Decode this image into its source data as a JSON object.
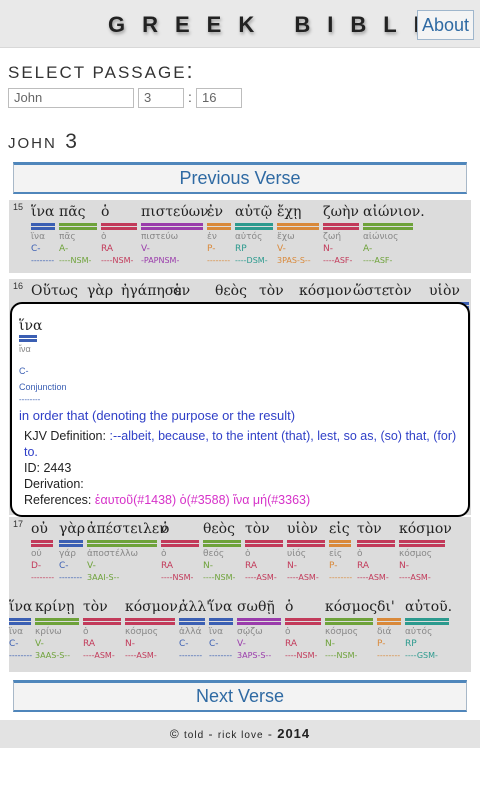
{
  "header": {
    "title": "GREEK BIBLE",
    "about_label": "About"
  },
  "select": {
    "label": "SELECT PASSAGE",
    "colon": ":",
    "book": "John",
    "chapter": "3",
    "verse_sep": ":",
    "verse": "16"
  },
  "chapter_heading": {
    "book": "JOHN",
    "number": "3"
  },
  "nav": {
    "prev_label": "Previous Verse",
    "next_label": "Next Verse"
  },
  "verses": {
    "v15": {
      "number": "15",
      "words": [
        {
          "greek": "ἵνα",
          "lemma": "ἵνα",
          "pos": "C-",
          "parse": "--------",
          "color": "blue"
        },
        {
          "greek": "πᾶς",
          "lemma": "πᾶς",
          "pos": "A-",
          "parse": "----NSM-",
          "color": "green"
        },
        {
          "greek": "ὁ",
          "lemma": "ὁ",
          "pos": "RA",
          "parse": "----NSM-",
          "color": "red"
        },
        {
          "greek": "πιστεύων",
          "lemma": "πιστεύω",
          "pos": "V-",
          "parse": "-PAPNSM-",
          "color": "purple"
        },
        {
          "greek": "ἐν",
          "lemma": "ἐν",
          "pos": "P-",
          "parse": "--------",
          "color": "orange"
        },
        {
          "greek": "αὐτῷ",
          "lemma": "αὐτός",
          "pos": "RP",
          "parse": "----DSM-",
          "color": "teal"
        },
        {
          "greek": "ἔχῃ",
          "lemma": "ἔχω",
          "pos": "V-",
          "parse": "3PAS-S--",
          "color": "orange"
        },
        {
          "greek": "ζωὴν",
          "lemma": "ζωή",
          "pos": "N-",
          "parse": "----ASF-",
          "color": "red"
        },
        {
          "greek": "αἰώνιον.",
          "lemma": "αἰώνιος",
          "pos": "A-",
          "parse": "----ASF-",
          "color": "green"
        }
      ]
    },
    "v16": {
      "number": "16",
      "words": [
        {
          "greek": "Οὕτως"
        },
        {
          "greek": "γὰρ"
        },
        {
          "greek": "ἠγάπησεν"
        },
        {
          "greek": "ὁ"
        },
        {
          "greek": "θεὸς"
        },
        {
          "greek": "τὸν"
        },
        {
          "greek": "κόσμον"
        },
        {
          "greek": "ὥστε"
        },
        {
          "greek": "τὸν"
        },
        {
          "greek": "υἱὸν"
        }
      ]
    },
    "v17": {
      "number": "17",
      "line1": [
        {
          "greek": "οὐ",
          "lemma": "οὐ",
          "pos": "D-",
          "parse": "--------",
          "color": "red"
        },
        {
          "greek": "γὰρ",
          "lemma": "γάρ",
          "pos": "C-",
          "parse": "--------",
          "color": "blue"
        },
        {
          "greek": "ἀπέστειλεν",
          "lemma": "ἀποστέλλω",
          "pos": "V-",
          "parse": "3AAI-S--",
          "color": "green"
        },
        {
          "greek": "ὁ",
          "lemma": "ὁ",
          "pos": "RA",
          "parse": "----NSM-",
          "color": "red"
        },
        {
          "greek": "θεὸς",
          "lemma": "θεός",
          "pos": "N-",
          "parse": "----NSM-",
          "color": "green"
        },
        {
          "greek": "τὸν",
          "lemma": "ὁ",
          "pos": "RA",
          "parse": "----ASM-",
          "color": "red"
        },
        {
          "greek": "υἱὸν",
          "lemma": "υἱός",
          "pos": "N-",
          "parse": "----ASM-",
          "color": "red"
        },
        {
          "greek": "εἰς",
          "lemma": "εἰς",
          "pos": "P-",
          "parse": "--------",
          "color": "orange"
        },
        {
          "greek": "τὸν",
          "lemma": "ὁ",
          "pos": "RA",
          "parse": "----ASM-",
          "color": "red"
        },
        {
          "greek": "κόσμον",
          "lemma": "κόσμος",
          "pos": "N-",
          "parse": "----ASM-",
          "color": "red"
        }
      ],
      "line2": [
        {
          "greek": "ἵνα",
          "lemma": "ἵνα",
          "pos": "C-",
          "parse": "--------",
          "color": "blue"
        },
        {
          "greek": "κρίνῃ",
          "lemma": "κρίνω",
          "pos": "V-",
          "parse": "3AAS-S--",
          "color": "green"
        },
        {
          "greek": "τὸν",
          "lemma": "ὁ",
          "pos": "RA",
          "parse": "----ASM-",
          "color": "red"
        },
        {
          "greek": "κόσμον,",
          "lemma": "κόσμος",
          "pos": "N-",
          "parse": "----ASM-",
          "color": "red"
        },
        {
          "greek": "ἀλλ'",
          "lemma": "ἀλλά",
          "pos": "C-",
          "parse": "--------",
          "color": "blue"
        },
        {
          "greek": "ἵνα",
          "lemma": "ἵνα",
          "pos": "C-",
          "parse": "--------",
          "color": "blue"
        },
        {
          "greek": "σωθῇ",
          "lemma": "σῴζω",
          "pos": "V-",
          "parse": "3APS-S--",
          "color": "purple"
        },
        {
          "greek": "ὁ",
          "lemma": "ὁ",
          "pos": "RA",
          "parse": "----NSM-",
          "color": "red"
        },
        {
          "greek": "κόσμος",
          "lemma": "κόσμος",
          "pos": "N-",
          "parse": "----NSM-",
          "color": "green"
        },
        {
          "greek": "δι'",
          "lemma": "διά",
          "pos": "P-",
          "parse": "--------",
          "color": "orange"
        },
        {
          "greek": "αὐτοῦ.",
          "lemma": "αὐτός",
          "pos": "RP",
          "parse": "----GSM-",
          "color": "teal"
        }
      ]
    }
  },
  "popup": {
    "word": "ἵνα",
    "lemma": "ἵνα",
    "code": "C-",
    "pos_name": "Conjunction",
    "parse": "--------",
    "definition": "in order that (denoting the purpose or the result)",
    "kjv_label": "KJV Definition:",
    "kjv_text": ":--albeit, because, to the intent (that), lest, so as, (so) that, (for) to.",
    "id_label": "ID:",
    "id": "2443",
    "derivation_label": "Derivation:",
    "references_label": "References:",
    "references": [
      "ἑαυτοῦ(#1438)",
      "ὁ(#3588)",
      "ἵνα μή(#3363)"
    ]
  },
  "footer": {
    "copyright": "©",
    "told": "told",
    "sep1": "-",
    "author": "rick love",
    "sep2": "-",
    "year": "2014"
  },
  "colors": {
    "blue": "#3b5fb3",
    "green": "#6ea23a",
    "red": "#c23a5a",
    "purple": "#9a3cab",
    "teal": "#2c9a8e",
    "orange": "#d9893a",
    "accent": "#4f86bb"
  }
}
